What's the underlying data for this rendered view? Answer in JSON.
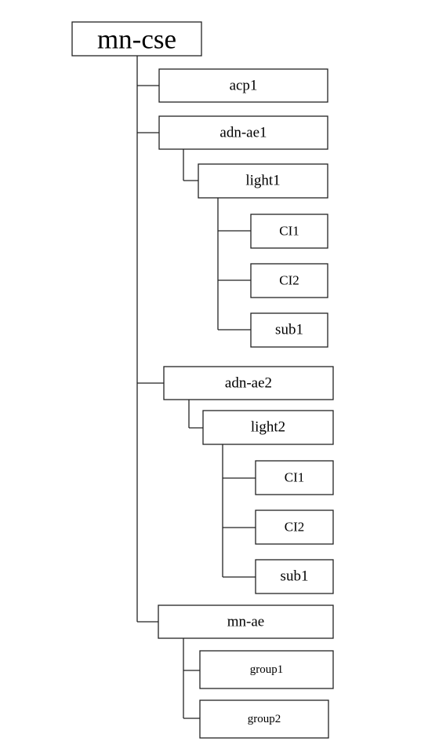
{
  "diagram": {
    "root": "mn-cse",
    "nodes": {
      "acp1": "acp1",
      "adn_ae1": "adn-ae1",
      "light1": "light1",
      "light1_ci1": "CI1",
      "light1_ci2": "CI2",
      "light1_sub1": "sub1",
      "adn_ae2": "adn-ae2",
      "light2": "light2",
      "light2_ci1": "CI1",
      "light2_ci2": "CI2",
      "light2_sub1": "sub1",
      "mn_ae": "mn-ae",
      "group1": "group1",
      "group2": "group2"
    }
  }
}
